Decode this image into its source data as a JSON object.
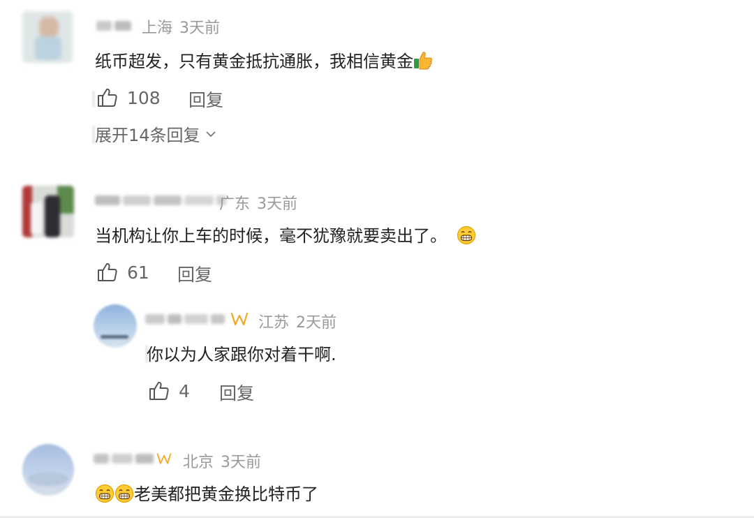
{
  "comments": [
    {
      "location": "上海",
      "time": "3天前",
      "text": "纸币超发，只有黄金抵抗通胀，我相信黄金",
      "text_emoji": "thumbs-up-emoji",
      "likes": "108",
      "reply_label": "回复",
      "expand_label": "展开14条回复"
    },
    {
      "location": "广东",
      "time": "3天前",
      "text": "当机构让你上车的时候，毫不犹豫就要卖出了。",
      "text_emoji": "grin-emoji",
      "likes": "61",
      "reply_label": "回复",
      "reply": {
        "location": "江苏",
        "time": "2天前",
        "text": "你以为人家跟你对着干啊.",
        "likes": "4",
        "reply_label": "回复"
      }
    },
    {
      "location": "北京",
      "time": "3天前",
      "text": "老美都把黄金换比特币了",
      "leading_emoji": "grin-emoji"
    }
  ],
  "icons": {
    "like": "thumbs-up-outline-icon",
    "vip": "vip-badge-icon",
    "expand": "chevron-down-icon"
  },
  "colors": {
    "meta_gray": "#999999",
    "action_gray": "#666666",
    "text": "#222222",
    "vip_orange": "#f5a623"
  }
}
